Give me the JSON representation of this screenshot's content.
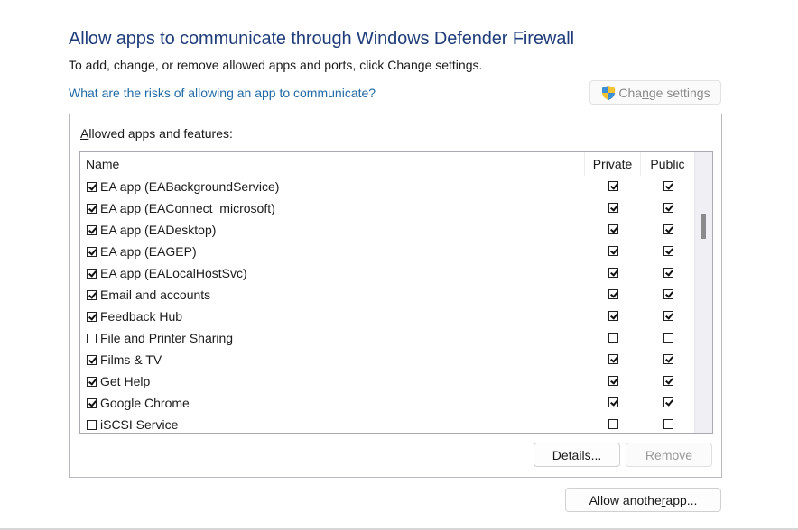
{
  "header": {
    "title": "Allow apps to communicate through Windows Defender Firewall",
    "subtitle": "To add, change, or remove allowed apps and ports, click Change settings.",
    "risk_link": "What are the risks of allowing an app to communicate?"
  },
  "change_settings": {
    "label_pre": "Cha",
    "label_accel": "n",
    "label_post": "ge settings",
    "icon": "uac-shield-icon",
    "enabled": false
  },
  "group": {
    "label_accel": "A",
    "label_rest": "llowed apps and features:"
  },
  "table": {
    "columns": [
      "Name",
      "Private",
      "Public"
    ],
    "rows": [
      {
        "name": "EA app (EABackgroundService)",
        "enabled": true,
        "private": true,
        "public": true
      },
      {
        "name": "EA app (EAConnect_microsoft)",
        "enabled": true,
        "private": true,
        "public": true
      },
      {
        "name": "EA app (EADesktop)",
        "enabled": true,
        "private": true,
        "public": true
      },
      {
        "name": "EA app (EAGEP)",
        "enabled": true,
        "private": true,
        "public": true
      },
      {
        "name": "EA app (EALocalHostSvc)",
        "enabled": true,
        "private": true,
        "public": true
      },
      {
        "name": "Email and accounts",
        "enabled": true,
        "private": true,
        "public": true
      },
      {
        "name": "Feedback Hub",
        "enabled": true,
        "private": true,
        "public": true
      },
      {
        "name": "File and Printer Sharing",
        "enabled": false,
        "private": false,
        "public": false
      },
      {
        "name": "Films & TV",
        "enabled": true,
        "private": true,
        "public": true
      },
      {
        "name": "Get Help",
        "enabled": true,
        "private": true,
        "public": true
      },
      {
        "name": "Google Chrome",
        "enabled": true,
        "private": true,
        "public": true
      },
      {
        "name": "iSCSI Service",
        "enabled": false,
        "private": false,
        "public": false
      }
    ]
  },
  "buttons": {
    "details_pre": "Detai",
    "details_accel": "l",
    "details_post": "s...",
    "remove_pre": "Re",
    "remove_accel": "m",
    "remove_post": "ove",
    "allow_pre": "Allow anothe",
    "allow_accel": "r",
    "allow_post": " app..."
  },
  "colors": {
    "title": "#1e3d7a",
    "link": "#1f6aa5",
    "disabled_text": "#9a9a9a"
  }
}
